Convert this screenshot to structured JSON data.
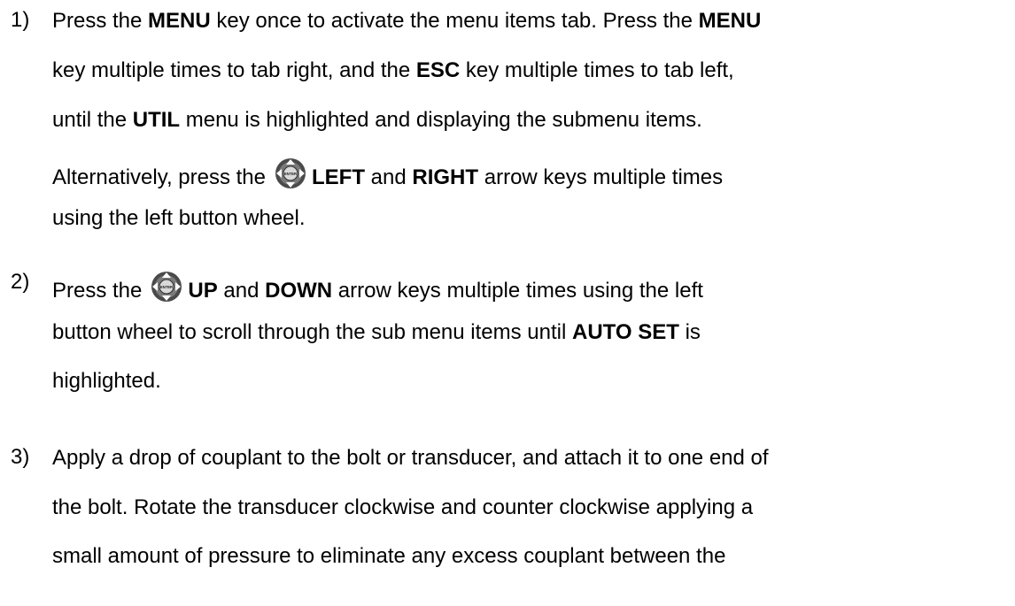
{
  "doc": {
    "item1": {
      "number": "1)",
      "l1_a": "Press the ",
      "l1_b": "MENU",
      "l1_c": " key once to activate the menu items tab.  Press the ",
      "l1_d": "MENU",
      "l2_a": "key multiple times to tab right, and the ",
      "l2_b": "ESC",
      "l2_c": " key multiple times to tab left,",
      "l3_a": "until the ",
      "l3_b": "UTIL",
      "l3_c": " menu is highlighted and displaying the submenu items.",
      "l4_a": "Alternatively, press the",
      "l4_b": "LEFT",
      "l4_c": " and ",
      "l4_d": "RIGHT",
      "l4_e": " arrow keys multiple times",
      "l5": "using the left button wheel."
    },
    "item2": {
      "number": "2)",
      "l1_a": "Press the",
      "l1_b": "UP",
      "l1_c": " and ",
      "l1_d": "DOWN",
      "l1_e": " arrow keys multiple times using the left",
      "l2_a": "button wheel to scroll through the sub menu items until ",
      "l2_b": "AUTO SET",
      "l2_c": " is",
      "l3": "highlighted."
    },
    "item3": {
      "number": "3)",
      "l1": "Apply a drop of couplant to the bolt or transducer, and attach it to one end of",
      "l2": "the bolt.  Rotate the transducer clockwise and counter clockwise applying a",
      "l3": "small amount of pressure to eliminate any excess couplant between the"
    },
    "icons": {
      "wheel_label": "ENTER",
      "wheel_color": "#4a4a4a"
    }
  }
}
